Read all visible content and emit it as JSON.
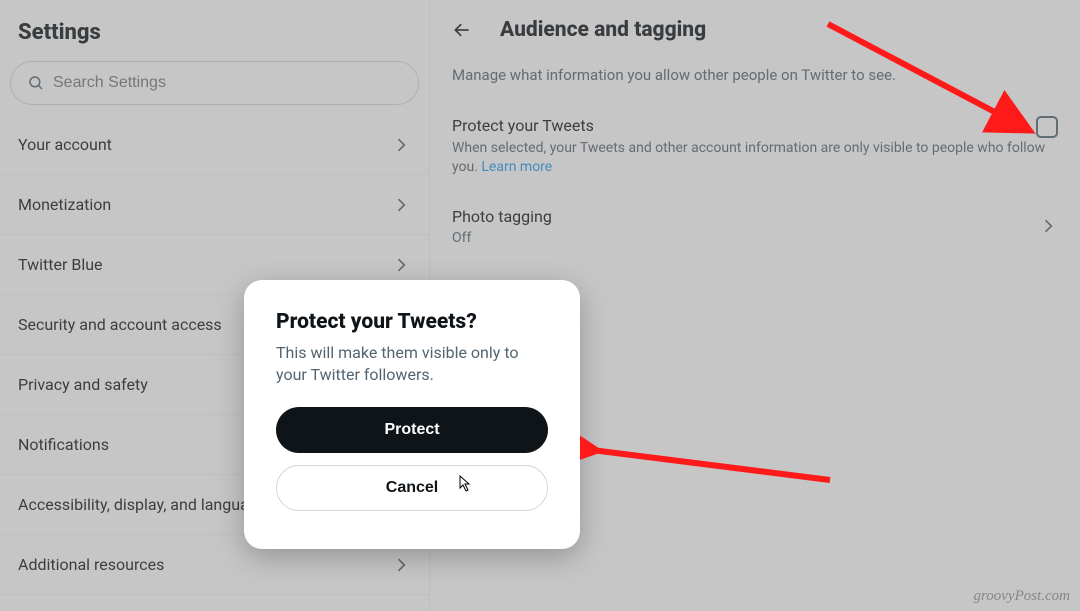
{
  "sidebar": {
    "title": "Settings",
    "search_placeholder": "Search Settings",
    "items": [
      {
        "label": "Your account"
      },
      {
        "label": "Monetization"
      },
      {
        "label": "Twitter Blue"
      },
      {
        "label": "Security and account access"
      },
      {
        "label": "Privacy and safety"
      },
      {
        "label": "Notifications"
      },
      {
        "label": "Accessibility, display, and languages"
      },
      {
        "label": "Additional resources"
      }
    ]
  },
  "main": {
    "title": "Audience and tagging",
    "subtitle": "Manage what information you allow other people on Twitter to see.",
    "protect": {
      "title": "Protect your Tweets",
      "desc_prefix": "When selected, your Tweets and other account information are only visible to people who follow you. ",
      "learn_more": "Learn more"
    },
    "photo_tagging": {
      "title": "Photo tagging",
      "value": "Off"
    }
  },
  "dialog": {
    "title": "Protect your Tweets?",
    "body": "This will make them visible only to your Twitter followers.",
    "primary": "Protect",
    "secondary": "Cancel"
  },
  "watermark": "groovyPost.com"
}
